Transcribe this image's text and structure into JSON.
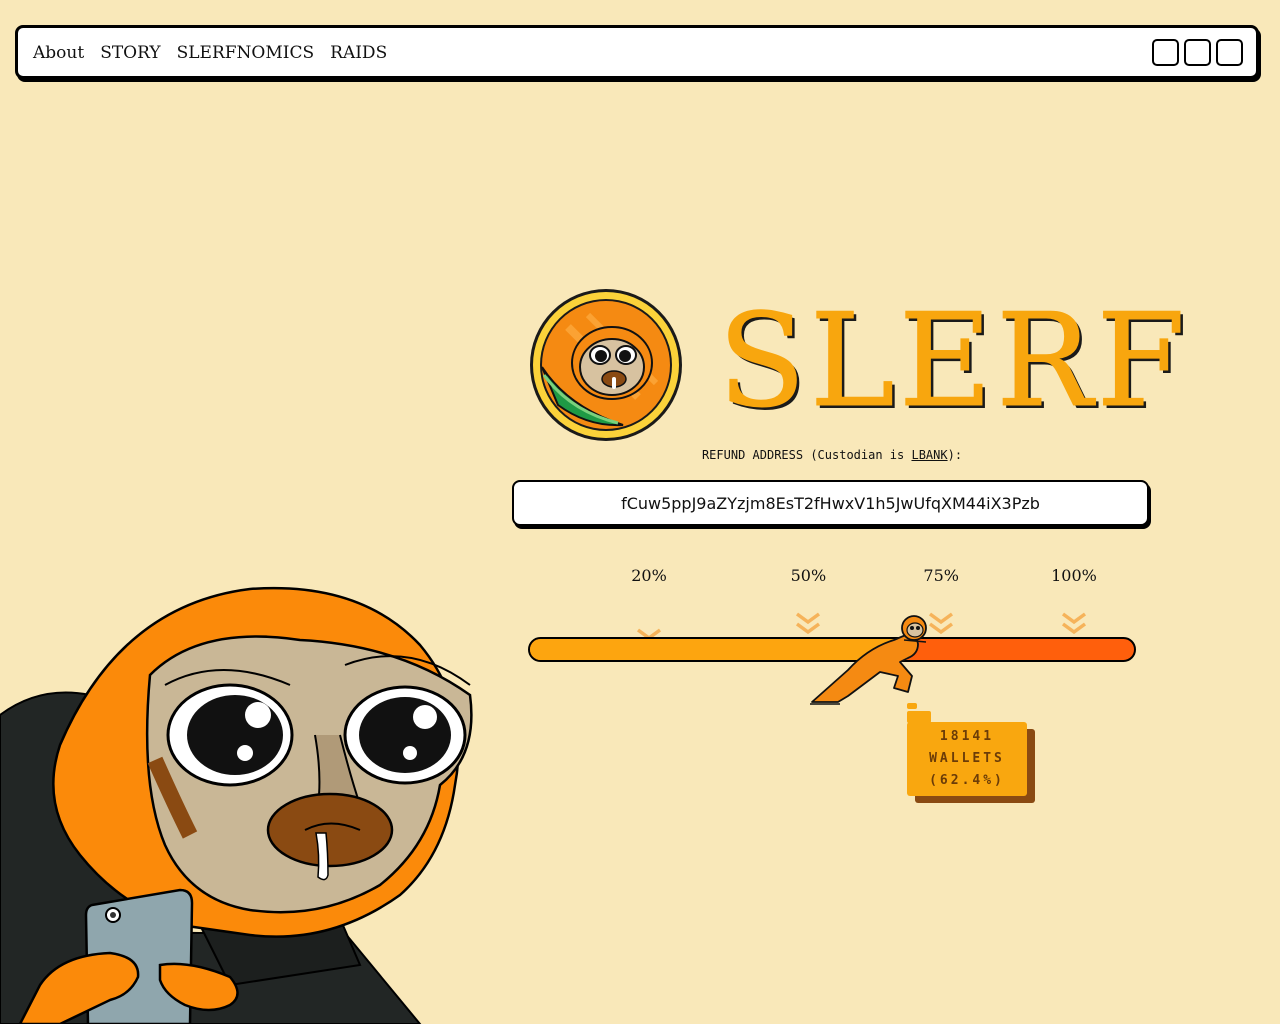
{
  "nav": {
    "links": [
      "About",
      "STORY",
      "SLERFNOMICS",
      "RAIDS"
    ],
    "icons": [
      "telegram-icon",
      "twitter-icon",
      "chart-icon"
    ]
  },
  "brand": {
    "name": "SLERF",
    "color": "#f8a60e"
  },
  "refund": {
    "label_prefix": "REFUND ADDRESS (Custodian is ",
    "custodian": "LBANK",
    "label_suffix": "):",
    "address": "fCuw5ppJ9aZYzjm8EsT2fHwxV1h5JwUfqXM44iX3Pzb"
  },
  "progress": {
    "markers": [
      {
        "label": "20%",
        "value": 0.2
      },
      {
        "label": "50%",
        "value": 0.5
      },
      {
        "label": "75%",
        "value": 0.75
      },
      {
        "label": "100%",
        "value": 1.0
      }
    ],
    "fill_fraction": 0.624,
    "fill_color": "#fda50f",
    "track_color": "#ff5f0c"
  },
  "wallets": {
    "count": "18141",
    "label": "WALLETS",
    "percent": "(62.4%)"
  }
}
